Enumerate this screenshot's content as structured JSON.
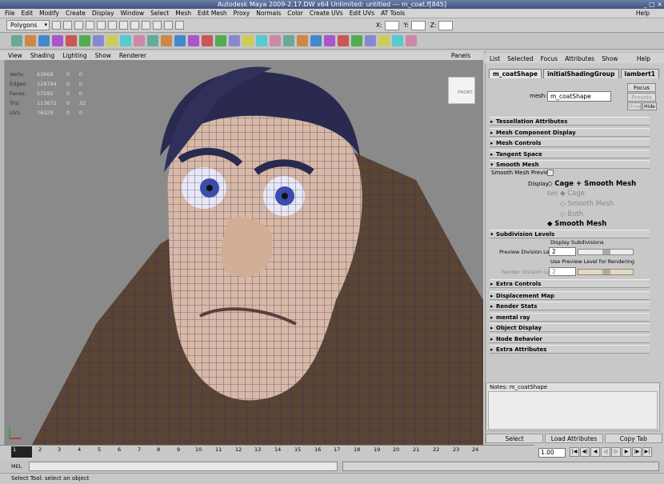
{
  "window": {
    "title": "Autodesk Maya 2009-2.17.DW x64 Unlimited: untitled   ---   m_coat.f[845]",
    "controls": "_ □ ×"
  },
  "menubar": [
    "File",
    "Edit",
    "Modify",
    "Create",
    "Display",
    "Window",
    "Select",
    "Mesh",
    "Edit Mesh",
    "Proxy",
    "Normals",
    "Color",
    "Create UVs",
    "Edit UVs",
    "AT Tools"
  ],
  "menubar_help": "Help",
  "status": {
    "menuset": "Polygons",
    "x_label": "X:",
    "y_label": "Y:",
    "z_label": "Z:"
  },
  "panel_menu": [
    "View",
    "Shading",
    "Lighting",
    "Show",
    "Renderer"
  ],
  "panels_label": "Panels",
  "hud": {
    "rows": [
      {
        "label": "Verts:",
        "a": "63668",
        "b": "0",
        "c": "0"
      },
      {
        "label": "Edges:",
        "a": "128794",
        "b": "0",
        "c": "0"
      },
      {
        "label": "Faces:",
        "a": "57292",
        "b": "0",
        "c": "0"
      },
      {
        "label": "Tris:",
        "a": "113672",
        "b": "0",
        "c": "32"
      },
      {
        "label": "UVs:",
        "a": "76329",
        "b": "0",
        "c": "0"
      }
    ]
  },
  "viewcube_label": "FRONT",
  "attr_editor": {
    "menu": [
      "List",
      "Selected",
      "Focus",
      "Attributes",
      "Show"
    ],
    "help": "Help",
    "tabs": [
      "m_coatShape",
      "initialShadingGroup",
      "lambert1"
    ],
    "focus": "Focus",
    "presets": "Presets",
    "show": "Show",
    "hide": "Hide",
    "mesh_label": "mesh:",
    "mesh_value": "m_coatShape",
    "sections": [
      "Tessellation Attributes",
      "Mesh Component Display",
      "Mesh Controls",
      "Tangent Space",
      "Smooth Mesh"
    ],
    "smooth_mesh_preview": "Smooth Mesh Preview",
    "display_label": "Display",
    "display_value": "Cage + Smooth Mesh",
    "edit_label": "Edit",
    "edit_options": [
      "Cage",
      "Smooth Mesh",
      "Both"
    ],
    "smooth_mesh_option": "Smooth Mesh",
    "subdiv_section": "Subdivision Levels",
    "display_subdivisions": "Display Subdivisions",
    "preview_division_label": "Preview Division Levels",
    "preview_division_value": "2",
    "use_preview_label": "Use Preview Level for Rendering",
    "render_division_label": "Render Division Levels",
    "render_division_value": "2",
    "sections2": [
      "Extra Controls",
      "Displacement Map",
      "Render Stats",
      "mental ray",
      "Object Display",
      "Node Behavior",
      "Extra Attributes"
    ],
    "notes_label": "Notes:  m_coatShape",
    "buttons": [
      "Select",
      "Load Attributes",
      "Copy Tab"
    ]
  },
  "timeline": {
    "ticks": [
      "1",
      "2",
      "3",
      "4",
      "5",
      "6",
      "7",
      "8",
      "9",
      "10",
      "11",
      "12",
      "13",
      "14",
      "15",
      "16",
      "17",
      "18",
      "19",
      "20",
      "21",
      "22",
      "23",
      "24"
    ],
    "current": "1",
    "frame_field": "1.00"
  },
  "command_line": {
    "label": "MEL"
  },
  "help_line": "Select Tool: select an object",
  "colors": {
    "accent": "#3f557f",
    "viewport": "#8a8a8a",
    "skin": "#d9b9a3",
    "wire": "#20208a",
    "coat": "#5a4434"
  }
}
